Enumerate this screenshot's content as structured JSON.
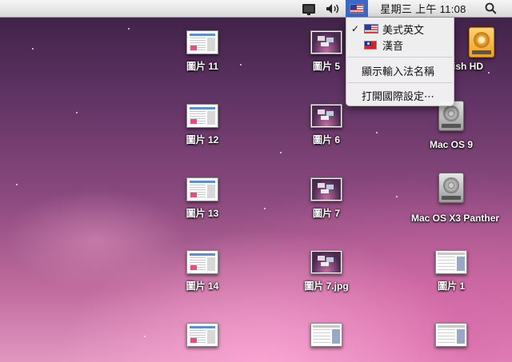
{
  "menubar": {
    "display_icon": "monitor-icon",
    "volume_icon": "speaker-volume-icon",
    "input_icon": "us-flag-icon",
    "clock": "星期三 上午 11:08",
    "spotlight_icon": "magnifier-icon"
  },
  "input_menu": {
    "items": [
      {
        "label": "美式英文",
        "checked": true,
        "icon": "us-flag-icon"
      },
      {
        "label": "漢音",
        "checked": false,
        "icon": "taiwan-flag-icon"
      },
      {
        "label": "顯示輸入法名稱"
      },
      {
        "label": "打開國際設定⋯"
      }
    ],
    "check_glyph": "✓"
  },
  "desktop": {
    "icons": [
      {
        "label": "圖片 11",
        "kind": "document-thumbnail"
      },
      {
        "label": "圖片 12",
        "kind": "document-thumbnail"
      },
      {
        "label": "圖片 13",
        "kind": "document-thumbnail"
      },
      {
        "label": "圖片 14",
        "kind": "document-thumbnail"
      },
      {
        "label": "圖片 5",
        "kind": "screenshot-thumbnail"
      },
      {
        "label": "圖片 6",
        "kind": "screenshot-thumbnail"
      },
      {
        "label": "圖片 7",
        "kind": "screenshot-thumbnail"
      },
      {
        "label": "圖片 7.jpg",
        "kind": "screenshot-thumbnail"
      },
      {
        "label": "ish HD",
        "kind": "hard-drive"
      },
      {
        "label": "Mac OS 9",
        "kind": "hard-drive"
      },
      {
        "label": "Mac OS X3 Panther",
        "kind": "hard-drive"
      },
      {
        "label": "圖片 1",
        "kind": "window-thumbnail"
      }
    ]
  },
  "colors": {
    "menu_highlight": "#3b68c7",
    "label_text": "#ffffff"
  }
}
